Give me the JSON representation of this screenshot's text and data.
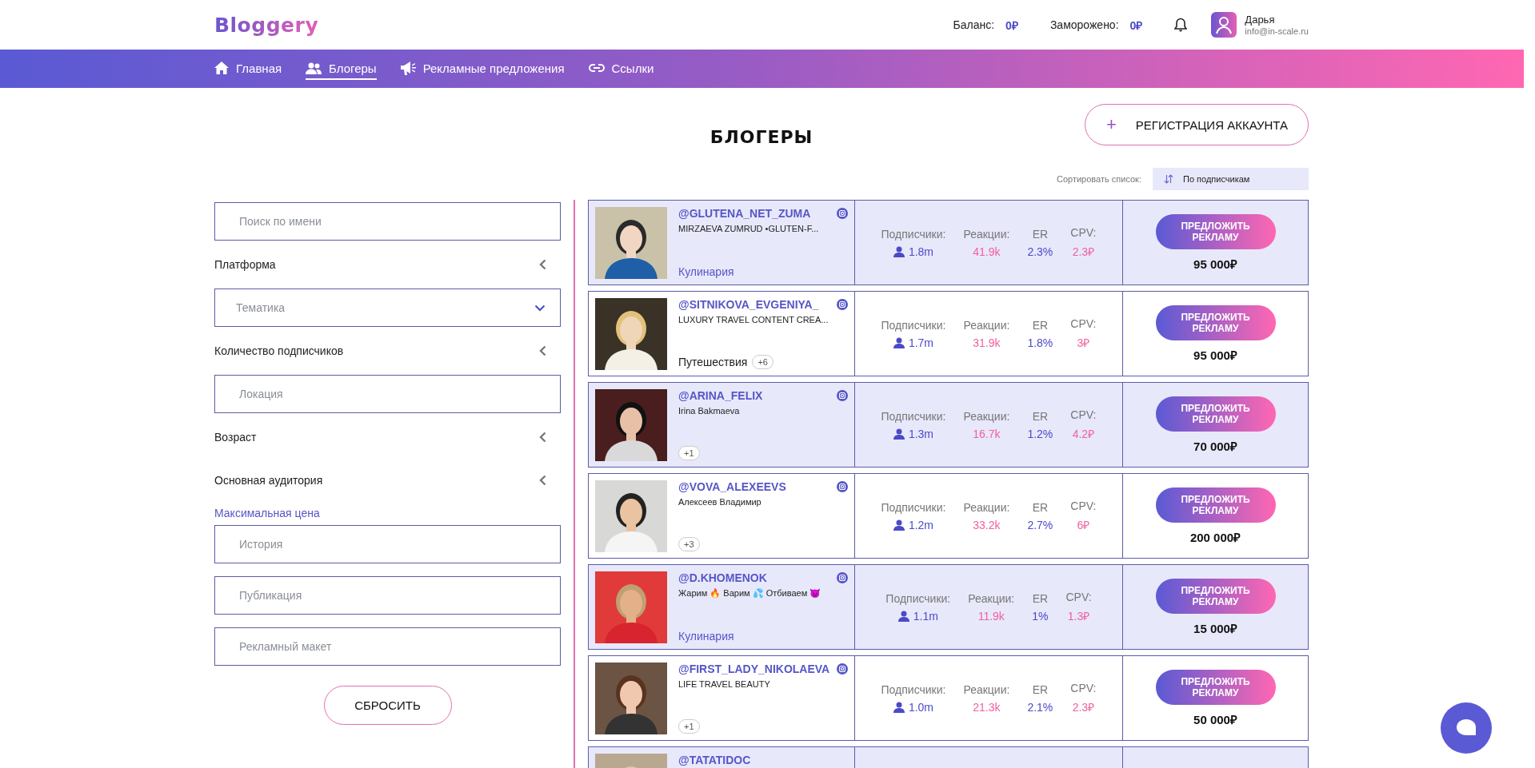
{
  "header": {
    "logo": "Bloggery",
    "balance_label": "Баланс:",
    "balance": "0₽",
    "frozen_label": "Заморожено:",
    "frozen": "0₽",
    "user_name": "Дарья",
    "user_email": "info@in-scale.ru"
  },
  "nav": [
    {
      "label": "Главная",
      "kind": "home",
      "selected": false
    },
    {
      "label": "Блогеры",
      "kind": "users",
      "selected": true
    },
    {
      "label": "Рекламные предложения",
      "kind": "megaphone",
      "selected": false
    },
    {
      "label": "Ссылки",
      "kind": "link",
      "selected": false
    }
  ],
  "page_title": "БЛОГЕРЫ",
  "register_button": {
    "icon": "+",
    "label": "РЕГИСТРАЦИЯ АККАУНТА"
  },
  "sort": {
    "label": "Сортировать список:",
    "value": "По подписчикам"
  },
  "filters": [
    {
      "kind": "field",
      "placeholder": "Поиск по имени"
    },
    {
      "kind": "collapsible",
      "label": "Платформа",
      "expanded": false
    },
    {
      "kind": "select",
      "placeholder": "Тематика"
    },
    {
      "kind": "collapsible",
      "label": "Количество подписчиков",
      "expanded": false
    },
    {
      "kind": "field",
      "placeholder": "Локация"
    },
    {
      "kind": "collapsible",
      "label": "Возраст",
      "expanded": false
    },
    {
      "kind": "collapsible",
      "label": "Основная аудитория",
      "expanded": false
    },
    {
      "kind": "heading",
      "label": "Максимальная цена"
    },
    {
      "kind": "field",
      "placeholder": "История"
    },
    {
      "kind": "field",
      "placeholder": "Публикация"
    },
    {
      "kind": "field",
      "placeholder": "Рекламный макет"
    }
  ],
  "reset_button": "СБРОСИТЬ",
  "bloggers": [
    {
      "handle": "@GLUTENA_NET_ZUMA",
      "description": "MIRZAEVA ZUMRUD •GLUTEN-F...",
      "category": "Кулинария",
      "highlighted": true,
      "stats": [
        {
          "kind": "subscribers",
          "label": "Подписчики:",
          "value": "1.8m"
        },
        {
          "kind": "reactions",
          "label": "Реакции:",
          "value": "41.9k"
        },
        {
          "kind": "er",
          "label": "ER",
          "value": "2.3%"
        },
        {
          "kind": "cpv",
          "label": "CPV:",
          "value": "2.3₽"
        }
      ],
      "offer_button": "ПРЕДЛОЖИТЬ РЕКЛАМУ",
      "price": "95 000₽"
    },
    {
      "handle": "@SITNIKOVA_EVGENIYA_",
      "description": "LUXURY TRAVEL CONTENT CREA...",
      "category": "Путешествия",
      "more": "+6",
      "highlighted": false,
      "stats": [
        {
          "kind": "subscribers",
          "label": "Подписчики:",
          "value": "1.7m"
        },
        {
          "kind": "reactions",
          "label": "Реакции:",
          "value": "31.9k"
        },
        {
          "kind": "er",
          "label": "ER",
          "value": "1.8%"
        },
        {
          "kind": "cpv",
          "label": "CPV:",
          "value": "3₽"
        }
      ],
      "offer_button": "ПРЕДЛОЖИТЬ РЕКЛАМУ",
      "price": "95 000₽"
    },
    {
      "handle": "@ARINA_FELIX",
      "description": "Irina Bakmaeva",
      "more": "+1",
      "highlighted": true,
      "stats": [
        {
          "kind": "subscribers",
          "label": "Подписчики:",
          "value": "1.3m"
        },
        {
          "kind": "reactions",
          "label": "Реакции:",
          "value": "16.7k"
        },
        {
          "kind": "er",
          "label": "ER",
          "value": "1.2%"
        },
        {
          "kind": "cpv",
          "label": "CPV:",
          "value": "4.2₽"
        }
      ],
      "offer_button": "ПРЕДЛОЖИТЬ РЕКЛАМУ",
      "price": "70 000₽"
    },
    {
      "handle": "@VOVA_ALEXEEVS",
      "description": "Алексеев Владимир",
      "more": "+3",
      "highlighted": false,
      "stats": [
        {
          "kind": "subscribers",
          "label": "Подписчики:",
          "value": "1.2m"
        },
        {
          "kind": "reactions",
          "label": "Реакции:",
          "value": "33.2k"
        },
        {
          "kind": "er",
          "label": "ER",
          "value": "2.7%"
        },
        {
          "kind": "cpv",
          "label": "CPV:",
          "value": "6₽"
        }
      ],
      "offer_button": "ПРЕДЛОЖИТЬ РЕКЛАМУ",
      "price": "200 000₽"
    },
    {
      "handle": "@D.KHOMENOK",
      "description": "Жарим 🔥 Варим 💦 Отбиваем 😈",
      "category": "Кулинария",
      "highlighted": true,
      "stats": [
        {
          "kind": "subscribers",
          "label": "Подписчики:",
          "value": "1.1m"
        },
        {
          "kind": "reactions",
          "label": "Реакции:",
          "value": "11.9k"
        },
        {
          "kind": "er",
          "label": "ER",
          "value": "1%"
        },
        {
          "kind": "cpv",
          "label": "CPV:",
          "value": "1.3₽"
        }
      ],
      "offer_button": "ПРЕДЛОЖИТЬ РЕКЛАМУ",
      "price": "15 000₽"
    },
    {
      "handle": "@FIRST_LADY_NIKOLAEVA",
      "description": "LIFE TRAVEL BEAUTY",
      "more": "+1",
      "highlighted": false,
      "stats": [
        {
          "kind": "subscribers",
          "label": "Подписчики:",
          "value": "1.0m"
        },
        {
          "kind": "reactions",
          "label": "Реакции:",
          "value": "21.3k"
        },
        {
          "kind": "er",
          "label": "ER",
          "value": "2.1%"
        },
        {
          "kind": "cpv",
          "label": "CPV:",
          "value": "2.3₽"
        }
      ],
      "offer_button": "ПРЕДЛОЖИТЬ РЕКЛАМУ",
      "price": "50 000₽"
    },
    {
      "handle": "@TATATIDOC",
      "highlighted": true
    }
  ]
}
